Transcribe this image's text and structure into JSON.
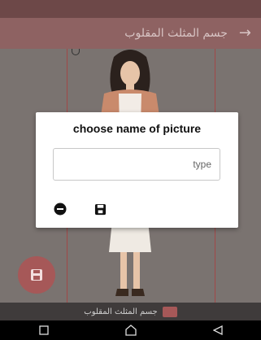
{
  "app_bar": {
    "title": "جسم المثلث المقلوب",
    "back_icon": "arrow-forward-icon"
  },
  "caption": {
    "text": "جسم المثلث المقلوب",
    "icon": "image-icon"
  },
  "dialog": {
    "title": "choose name of picture",
    "input_placeholder": "type",
    "input_value": "",
    "cancel_icon": "minus-circle-icon",
    "save_icon": "floppy-disk-icon"
  },
  "fab": {
    "icon": "floppy-disk-icon"
  },
  "nav": {
    "buttons": [
      "recent-apps-icon",
      "home-icon",
      "back-icon"
    ]
  },
  "colors": {
    "accent": "#a65858",
    "app_bar": "#8e6262",
    "status_bar": "#6d4848"
  }
}
